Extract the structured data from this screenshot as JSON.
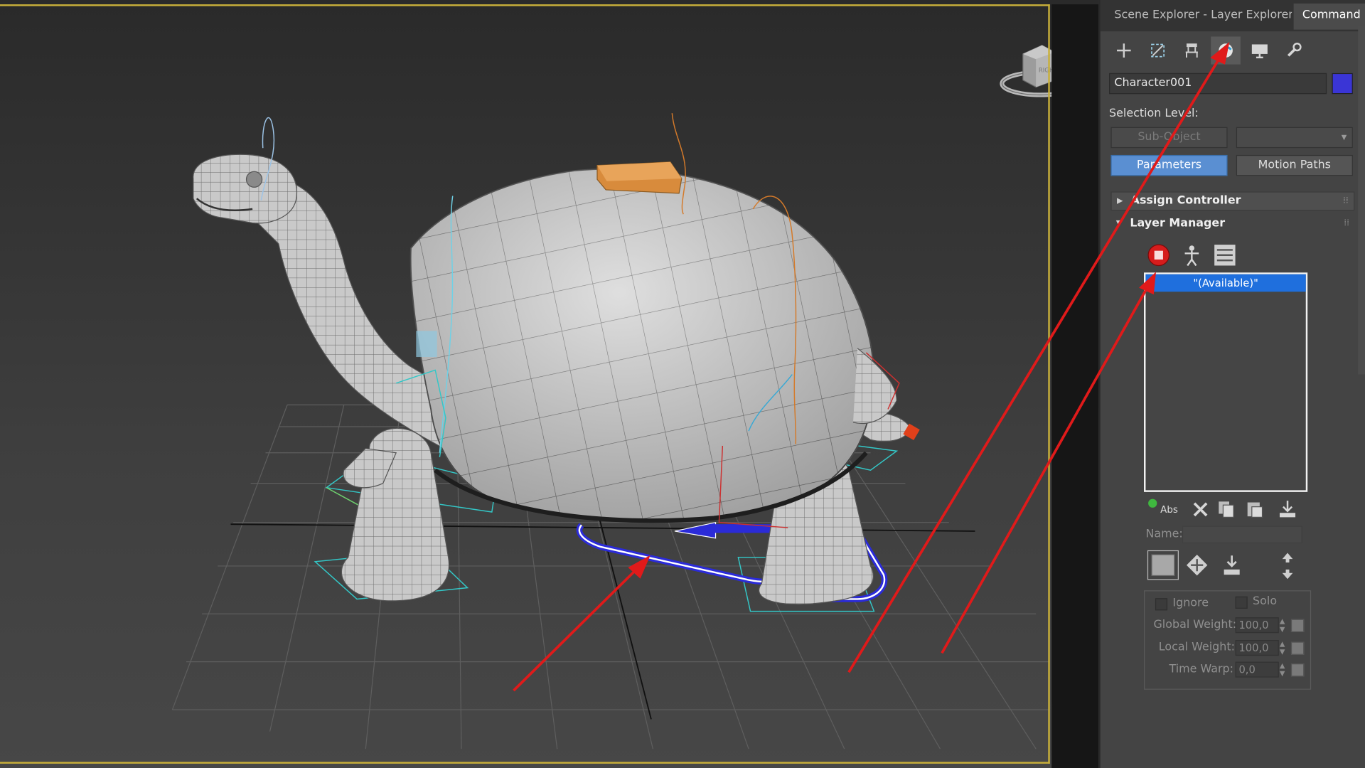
{
  "tabs": {
    "scene_explorer": "Scene Explorer - Layer Explorer",
    "command_panel": "Command Pa"
  },
  "toolbar": {
    "icons": [
      "create-icon",
      "modify-icon",
      "hierarchy-icon",
      "motion-icon",
      "display-icon",
      "utilities-icon"
    ],
    "active": "motion-icon"
  },
  "object": {
    "name": "Character001",
    "color": "#3a35d6"
  },
  "selection_level": {
    "label": "Selection Level:",
    "sub_object": "Sub-Object",
    "dropdown_value": ""
  },
  "mode_buttons": {
    "parameters": "Parameters",
    "motion_paths": "Motion Paths"
  },
  "rollouts": {
    "assign_controller": "Assign Controller",
    "layer_manager": "Layer Manager"
  },
  "layer_list": {
    "items": [
      "\"(Available)\""
    ]
  },
  "layer_tools": {
    "abs_label": "Abs"
  },
  "name_field": {
    "label": "Name:",
    "value": ""
  },
  "options": {
    "ignore": "Ignore",
    "solo": "Solo",
    "global_weight": {
      "label": "Global Weight:",
      "value": "100,0"
    },
    "local_weight": {
      "label": "Local Weight:",
      "value": "100,0"
    },
    "time_warp": {
      "label": "Time Warp:",
      "value": "0,0"
    }
  },
  "viewcube": {
    "face_label": "RIGHT"
  },
  "colors": {
    "viewport_border": "#c9b03a",
    "selection_blue": "#1f6fdd",
    "annotation_red": "#e01a1a",
    "footstep_blue": "#2b2bd8"
  }
}
